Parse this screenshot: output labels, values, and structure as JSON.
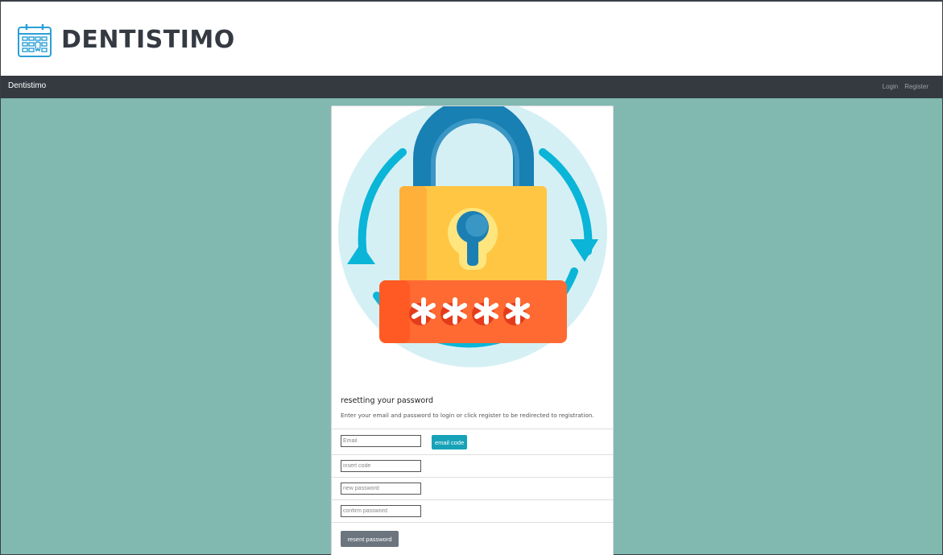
{
  "header": {
    "logo_text": "DENTISTIMO",
    "logo_icon": "calendar-tooth-icon"
  },
  "navbar": {
    "brand": "Dentistimo",
    "links": [
      {
        "label": "Login"
      },
      {
        "label": "Register"
      }
    ]
  },
  "card": {
    "illustration_icon": "padlock-reset-icon",
    "title": "resetting your password",
    "text": "Enter your email and password to login or click register to be redirected to registration.",
    "email_placeholder": "Email",
    "email_code_label": "email code",
    "code_placeholder": "insert code",
    "new_password_placeholder": "new password",
    "confirm_password_placeholder": "confirm password",
    "reset_label": "resent password"
  },
  "colors": {
    "background": "#81b9b1",
    "navbar": "#343a40",
    "accent": "#17a2b8",
    "secondary": "#6c757d"
  }
}
